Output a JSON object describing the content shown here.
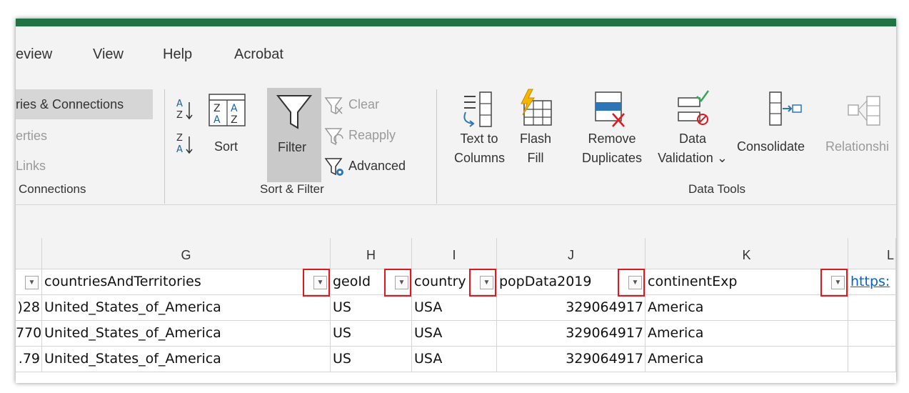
{
  "tabs": [
    "eview",
    "View",
    "Help",
    "Acrobat"
  ],
  "connections_group": {
    "items": [
      "ries & Connections",
      "erties",
      "Links"
    ],
    "label": "Connections"
  },
  "sort_filter_group": {
    "sort_label": "Sort",
    "filter_label": "Filter",
    "clear_label": "Clear",
    "reapply_label": "Reapply",
    "advanced_label": "Advanced",
    "label": "Sort & Filter"
  },
  "data_tools_group": {
    "text_to_columns": [
      "Text to",
      "Columns"
    ],
    "flash_fill": [
      "Flash",
      "Fill"
    ],
    "remove_duplicates": [
      "Remove",
      "Duplicates"
    ],
    "data_validation": [
      "Data",
      "Validation ⌄"
    ],
    "consolidate": "Consolidate",
    "relationships": "Relationshi",
    "label": "Data Tools"
  },
  "sheet": {
    "columns": [
      "G",
      "H",
      "I",
      "J",
      "K",
      "L"
    ],
    "headers": {
      "G": "countriesAndTerritories",
      "H": "geoId",
      "I": "country",
      "J": "popData2019",
      "K": "continentExp",
      "L": "https:"
    },
    "rows": [
      {
        "prefix": ")28",
        "country": "United_States_of_America",
        "geo": "US",
        "code": "USA",
        "pop": "329064917",
        "continent": "America"
      },
      {
        "prefix": "770",
        "country": "United_States_of_America",
        "geo": "US",
        "code": "USA",
        "pop": "329064917",
        "continent": "America"
      },
      {
        "prefix": ".79",
        "country": "United_States_of_America",
        "geo": "US",
        "code": "USA",
        "pop": "329064917",
        "continent": "America"
      }
    ]
  },
  "colors": {
    "excel_green": "#217346",
    "highlight_red": "#e0191f",
    "link_blue": "#0563c1"
  }
}
